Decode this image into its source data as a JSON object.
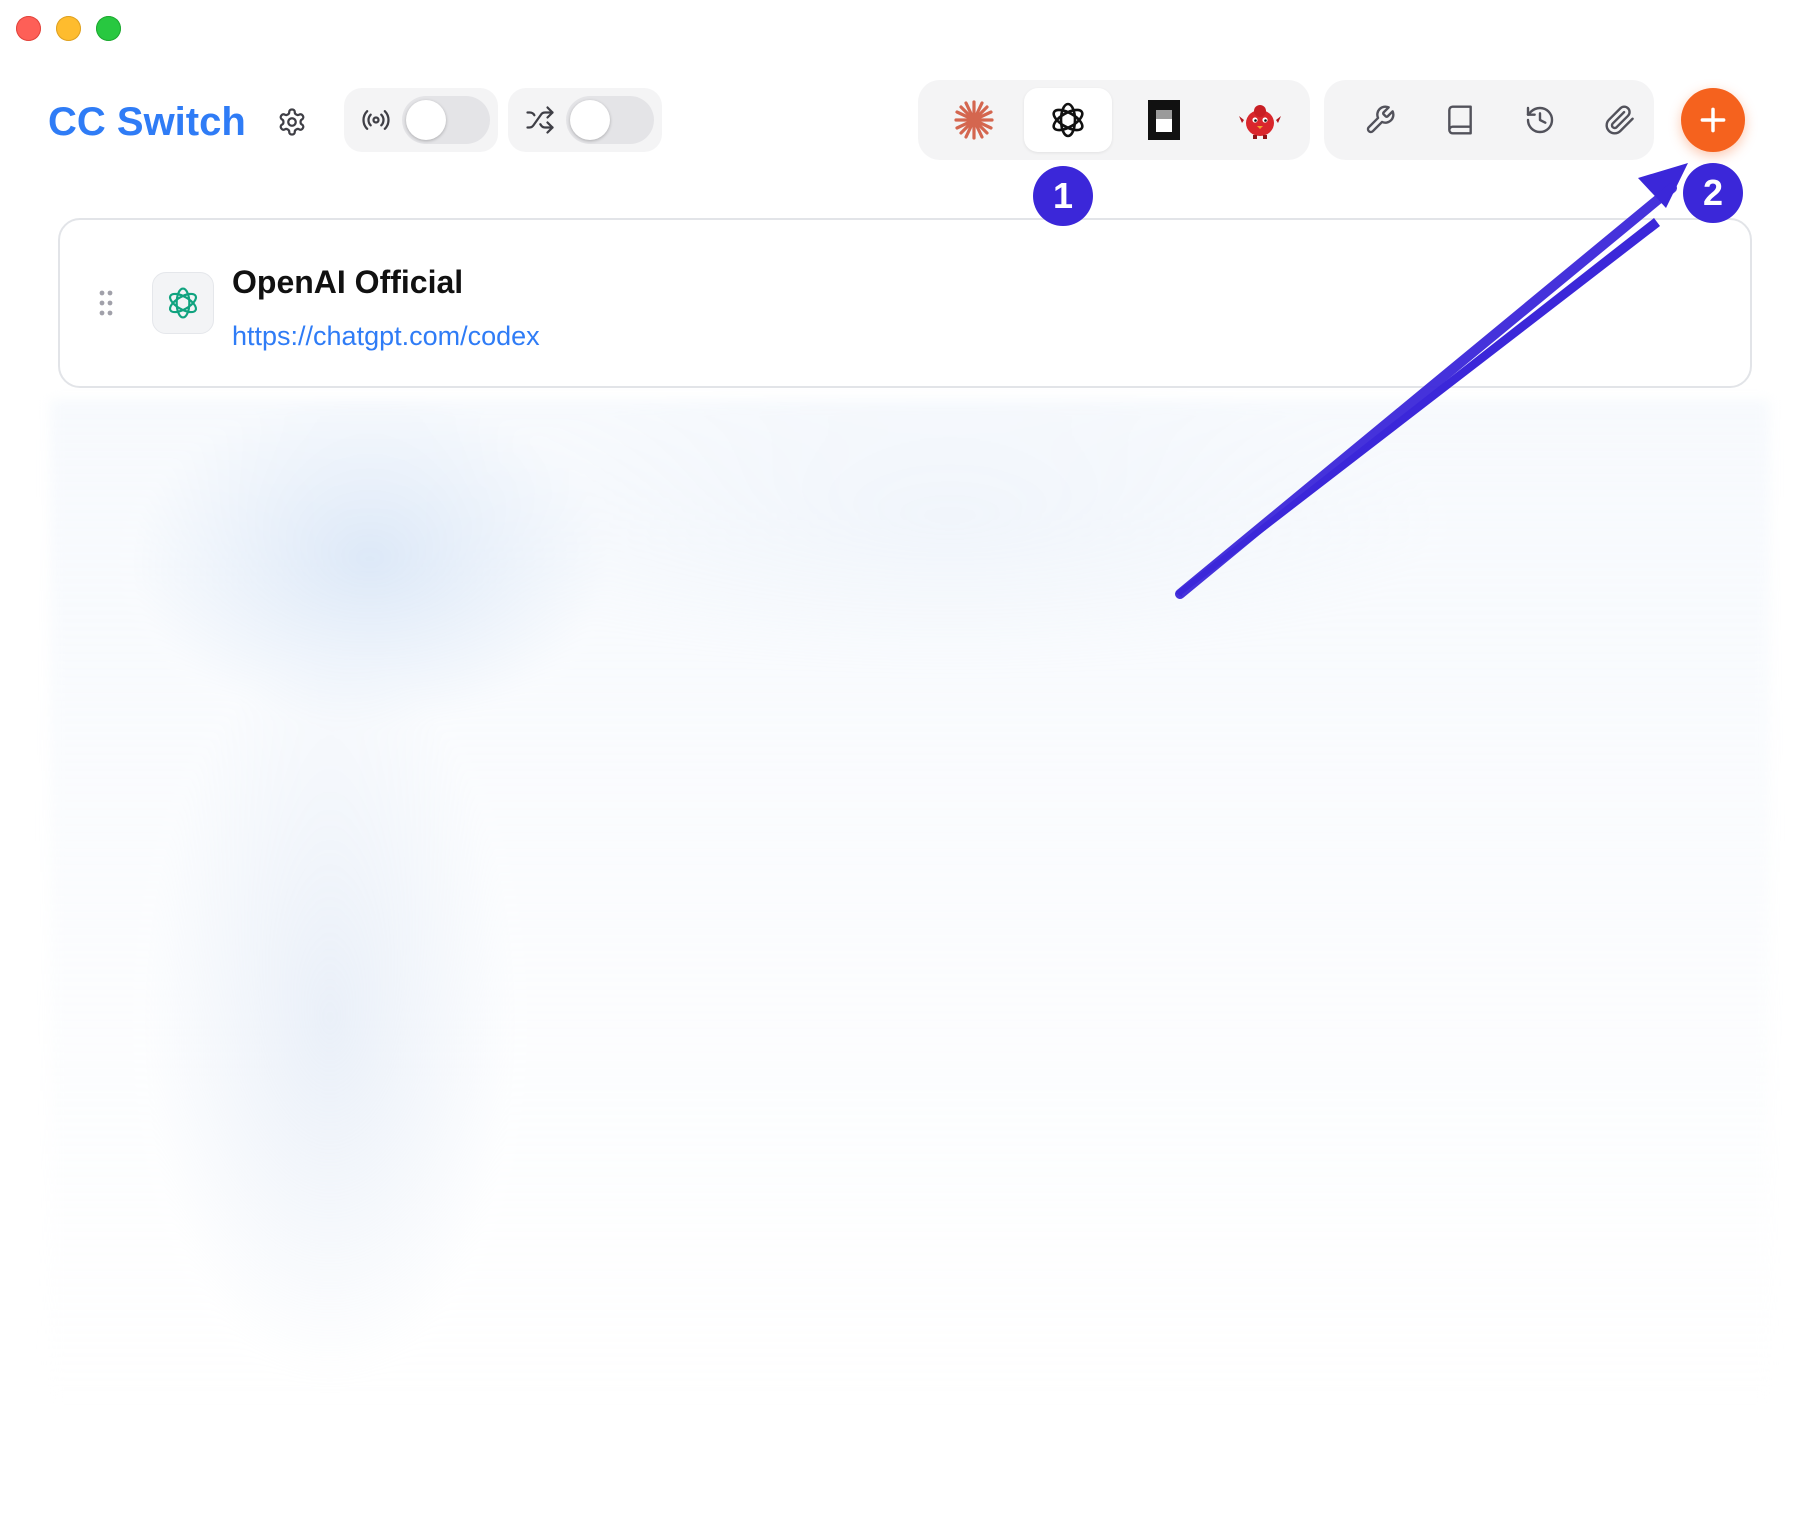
{
  "window": {
    "controls": [
      "close",
      "minimize",
      "maximize"
    ]
  },
  "header": {
    "title": "CC Switch",
    "title_color": "#2f7cf6",
    "settings_icon": "gear-icon",
    "proxy_toggle": {
      "icon": "broadcast-icon",
      "enabled": false
    },
    "failover_toggle": {
      "icon": "shuffle-icon",
      "enabled": false
    },
    "app_tabs": [
      {
        "name": "claude",
        "icon": "claude-starburst-icon",
        "active": false
      },
      {
        "name": "codex",
        "icon": "openai-icon",
        "active": true
      },
      {
        "name": "gemini",
        "icon": "black-square-icon",
        "active": false
      },
      {
        "name": "opencode",
        "icon": "red-bird-icon",
        "active": false
      }
    ],
    "tools": [
      {
        "name": "skills",
        "icon": "wrench-icon"
      },
      {
        "name": "prompts",
        "icon": "book-icon"
      },
      {
        "name": "history",
        "icon": "history-icon"
      },
      {
        "name": "mcp",
        "icon": "paperclip-icon"
      }
    ],
    "add_button": {
      "icon": "plus-icon",
      "color": "#f5621e"
    }
  },
  "annotations": {
    "badge1": "1",
    "badge2": "2",
    "color": "#3b27d9"
  },
  "providers": [
    {
      "name": "OpenAI Official",
      "url": "https://chatgpt.com/codex",
      "icon": "openai-icon"
    }
  ]
}
